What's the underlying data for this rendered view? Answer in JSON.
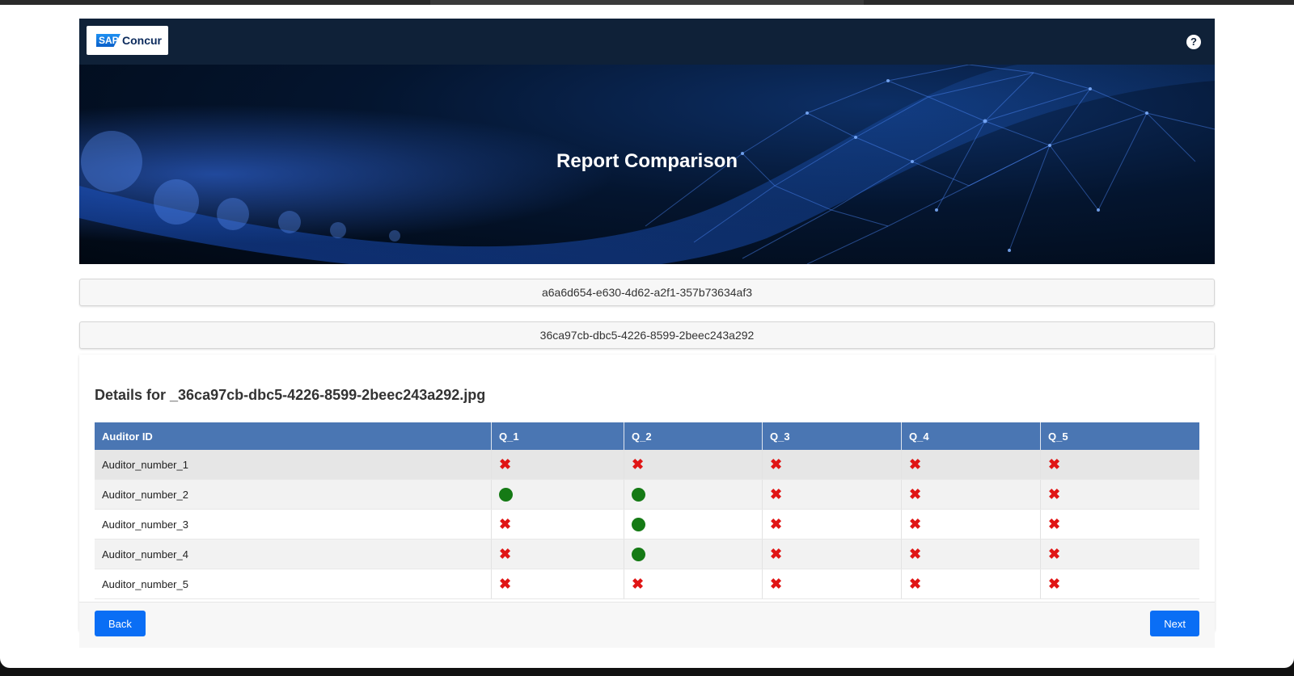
{
  "header": {
    "logo_sap": "SAP",
    "logo_concur": "Concur",
    "help_icon": "?"
  },
  "banner": {
    "title": "Report Comparison"
  },
  "ids": {
    "first": "a6a6d654-e630-4d62-a2f1-357b73634af3",
    "second": "36ca97cb-dbc5-4226-8599-2beec243a292"
  },
  "details": {
    "title": "Details for _36ca97cb-dbc5-4226-8599-2beec243a292.jpg",
    "columns": [
      "Auditor ID",
      "Q_1",
      "Q_2",
      "Q_3",
      "Q_4",
      "Q_5"
    ],
    "rows": [
      {
        "id": "Auditor_number_1",
        "marks": [
          "cross-icon",
          "cross-icon",
          "cross-icon",
          "cross-icon",
          "cross-icon"
        ]
      },
      {
        "id": "Auditor_number_2",
        "marks": [
          "check-dot-icon",
          "check-dot-icon",
          "cross-icon",
          "cross-icon",
          "cross-icon"
        ]
      },
      {
        "id": "Auditor_number_3",
        "marks": [
          "cross-icon",
          "check-dot-icon",
          "cross-icon",
          "cross-icon",
          "cross-icon"
        ]
      },
      {
        "id": "Auditor_number_4",
        "marks": [
          "cross-icon",
          "check-dot-icon",
          "cross-icon",
          "cross-icon",
          "cross-icon"
        ]
      },
      {
        "id": "Auditor_number_5",
        "marks": [
          "cross-icon",
          "cross-icon",
          "cross-icon",
          "cross-icon",
          "cross-icon"
        ]
      }
    ]
  },
  "footer": {
    "back_label": "Back",
    "next_label": "Next"
  },
  "colors": {
    "header_bg": "#0f2138",
    "table_header": "#4a76b3",
    "cross": "#e01515",
    "ok": "#157a15",
    "button": "#0a6ef5"
  }
}
